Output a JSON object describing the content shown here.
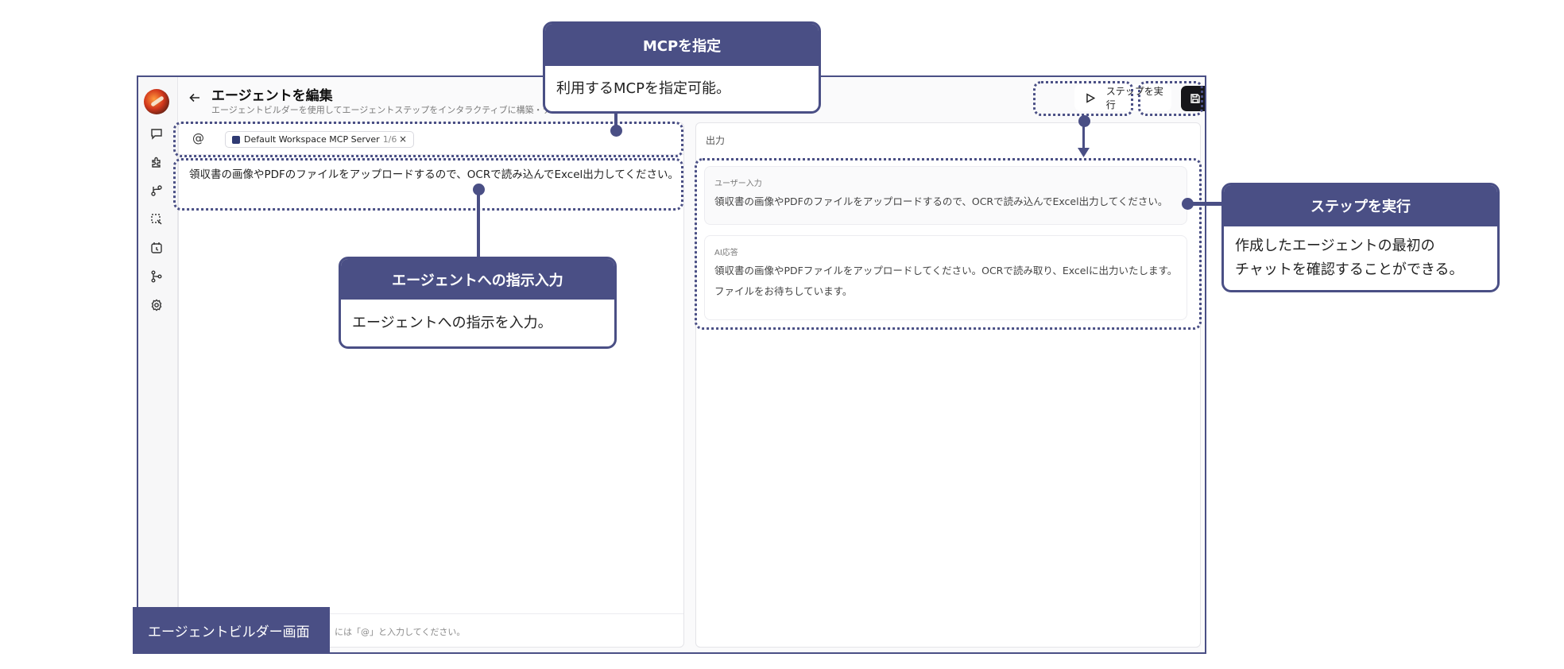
{
  "header": {
    "title": "エージェントを編集",
    "subtitle": "エージェントビルダーを使用してエージェントステップをインタラクティブに構築・テストします",
    "run_label": "ステップを実行",
    "save_label": "保存"
  },
  "sidebar": {
    "items": [
      {
        "icon": "chat-icon"
      },
      {
        "icon": "puzzle-icon"
      },
      {
        "icon": "branch-icon"
      },
      {
        "icon": "selection-icon"
      },
      {
        "icon": "schedule-icon"
      },
      {
        "icon": "merge-icon"
      },
      {
        "icon": "settings-icon"
      }
    ]
  },
  "editor": {
    "at_symbol": "@",
    "mcp_chip": {
      "name": "Default Workspace MCP Server",
      "count": "1/6",
      "close": "×"
    },
    "prompt": "領収書の画像やPDFのファイルをアップロードするので、OCRで読み込んでExcel出力してください。",
    "footer_hint": "には「@」と入力してください。"
  },
  "output": {
    "title": "出力",
    "user_label": "ユーザー入力",
    "user_text": "領収書の画像やPDFのファイルをアップロードするので、OCRで読み込んでExcel出力してください。",
    "ai_label": "AI応答",
    "ai_text": "領収書の画像やPDFファイルをアップロードしてください。OCRで読み取り、Excelに出力いたします。ファイルをお待ちしています。"
  },
  "callouts": {
    "mcp": {
      "title": "MCPを指定",
      "body": "利用するMCPを指定可能。"
    },
    "instruction": {
      "title": "エージェントへの指示入力",
      "body": "エージェントへの指示を入力。"
    },
    "run": {
      "title": "ステップを実行",
      "body_line1": "作成したエージェントの最初の",
      "body_line2": "チャットを確認することができる。"
    }
  },
  "corner_label": "エージェントビルダー画面",
  "colors": {
    "accent": "#4a4f85",
    "save_button": "#16161a"
  }
}
